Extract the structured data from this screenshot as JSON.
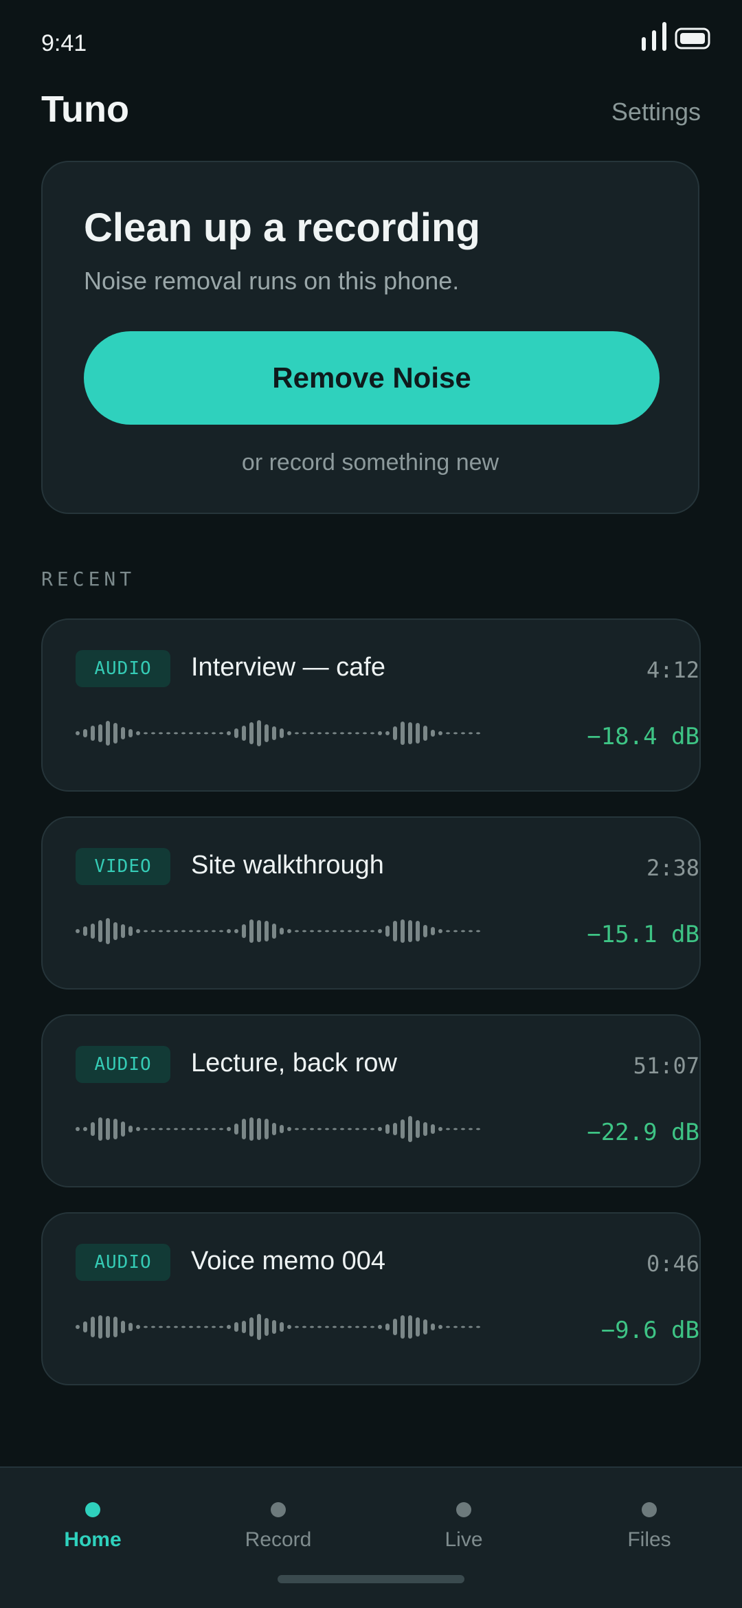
{
  "status_bar": {
    "time": "9:41"
  },
  "header": {
    "app_title": "Tuno",
    "settings_label": "Settings"
  },
  "hero": {
    "title": "Clean up a recording",
    "subtitle": "Noise removal runs on this phone.",
    "primary_button": "Remove Noise",
    "secondary_link": "or record something new"
  },
  "recent": {
    "section_label": "RECENT",
    "items": [
      {
        "type": "AUDIO",
        "title": "Interview — cafe",
        "duration": "4:12",
        "level": "−18.4 dB"
      },
      {
        "type": "VIDEO",
        "title": "Site walkthrough",
        "duration": "2:38",
        "level": "−15.1 dB"
      },
      {
        "type": "AUDIO",
        "title": "Lecture, back row",
        "duration": "51:07",
        "level": "−22.9 dB"
      },
      {
        "type": "AUDIO",
        "title": "Voice memo 004",
        "duration": "0:46",
        "level": "−9.6 dB"
      }
    ]
  },
  "nav": {
    "items": [
      {
        "label": "Home",
        "active": true
      },
      {
        "label": "Record",
        "active": false
      },
      {
        "label": "Live",
        "active": false
      },
      {
        "label": "Files",
        "active": false
      }
    ]
  },
  "colors": {
    "accent": "#2fd1bd",
    "background": "#0c1416",
    "card": "#172226",
    "level_text": "#3ec485",
    "badge_bg": "#123a36"
  },
  "icons": {
    "signal": "signal-icon",
    "battery": "battery-icon"
  }
}
